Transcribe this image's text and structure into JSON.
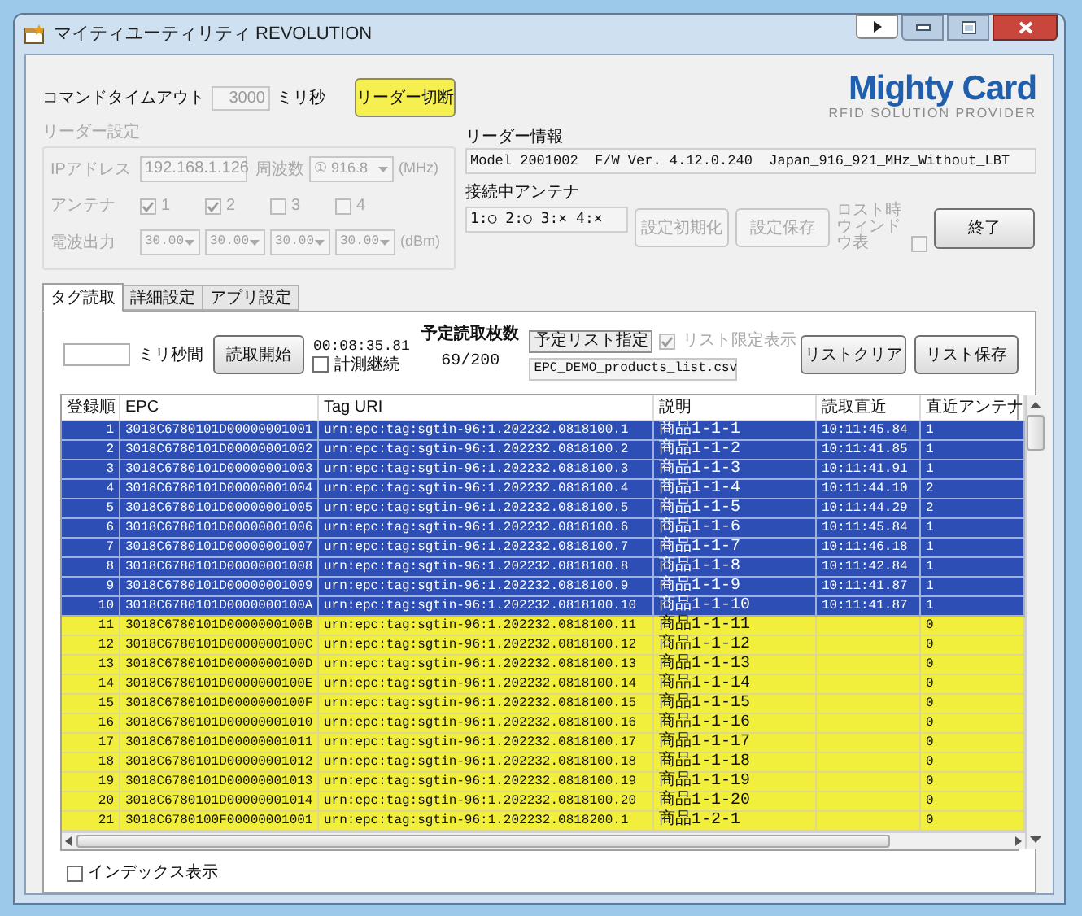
{
  "window": {
    "title": "マイティユーティリティ REVOLUTION"
  },
  "command_timeout": {
    "label": "コマンドタイムアウト",
    "value": "3000",
    "unit": "ミリ秒"
  },
  "disconnect_button": "リーダー切断",
  "reader_settings": {
    "title": "リーダー設定",
    "disabled": true,
    "ip_label": "IPアドレス",
    "ip_value": "192.168.1.126",
    "frequency_label": "周波数",
    "frequency_value": "① 916.8",
    "frequency_unit": "(MHz)",
    "antenna_label": "アンテナ",
    "antennas": [
      {
        "label": "1",
        "checked": true
      },
      {
        "label": "2",
        "checked": true
      },
      {
        "label": "3",
        "checked": false
      },
      {
        "label": "4",
        "checked": false
      }
    ],
    "power_label": "電波出力",
    "powers": [
      "30.00",
      "30.00",
      "30.00",
      "30.00"
    ],
    "power_unit": "(dBm)"
  },
  "logo": {
    "name": "Mighty Card",
    "tagline": "RFID SOLUTION PROVIDER"
  },
  "reader_info": {
    "label": "リーダー情報",
    "value": "Model 2001002  F/W Ver. 4.12.0.240  Japan_916_921_MHz_Without_LBT"
  },
  "connected_antennas": {
    "label": "接続中アンテナ",
    "value": "1:○ 2:○ 3:× 4:×"
  },
  "setting_buttons": [
    {
      "label": "設定初期化",
      "disabled": true
    },
    {
      "label": "設定保存",
      "disabled": true
    }
  ],
  "lost_window_option": {
    "label": "ロスト時ウィンドウ表",
    "checked": false,
    "disabled": true
  },
  "exit_button": "終了",
  "tabs": [
    {
      "label": "タグ読取",
      "selected": true
    },
    {
      "label": "詳細設定",
      "selected": false
    },
    {
      "label": "アプリ設定",
      "selected": false
    }
  ],
  "read_panel": {
    "interval_unit": "ミリ秒間",
    "start_button": "読取開始",
    "elapsed": "00:08:35.81",
    "continue_option": {
      "label": "計測継続",
      "checked": false
    },
    "planned_label": "予定読取枚数",
    "planned_count": "69/200",
    "list_button": "予定リスト指定",
    "list_only_option": {
      "label": "リスト限定表示",
      "checked": true,
      "disabled": true
    },
    "list_file": "EPC_DEMO_products_list.csv",
    "clear_button": "リストクリア",
    "save_button": "リスト保存"
  },
  "table": {
    "columns": [
      "登録順",
      "EPC",
      "Tag URI",
      "説明",
      "読取直近",
      "直近アンテナ"
    ],
    "rows": [
      {
        "no": "1",
        "epc": "3018C6780101D00000001001",
        "tag_uri": "urn:epc:tag:sgtin-96:1.202232.0818100.1",
        "description": "商品1-1-1",
        "last_read": "10:11:45.84",
        "antenna": "1",
        "read": true
      },
      {
        "no": "2",
        "epc": "3018C6780101D00000001002",
        "tag_uri": "urn:epc:tag:sgtin-96:1.202232.0818100.2",
        "description": "商品1-1-2",
        "last_read": "10:11:41.85",
        "antenna": "1",
        "read": true
      },
      {
        "no": "3",
        "epc": "3018C6780101D00000001003",
        "tag_uri": "urn:epc:tag:sgtin-96:1.202232.0818100.3",
        "description": "商品1-1-3",
        "last_read": "10:11:41.91",
        "antenna": "1",
        "read": true
      },
      {
        "no": "4",
        "epc": "3018C6780101D00000001004",
        "tag_uri": "urn:epc:tag:sgtin-96:1.202232.0818100.4",
        "description": "商品1-1-4",
        "last_read": "10:11:44.10",
        "antenna": "2",
        "read": true
      },
      {
        "no": "5",
        "epc": "3018C6780101D00000001005",
        "tag_uri": "urn:epc:tag:sgtin-96:1.202232.0818100.5",
        "description": "商品1-1-5",
        "last_read": "10:11:44.29",
        "antenna": "2",
        "read": true
      },
      {
        "no": "6",
        "epc": "3018C6780101D00000001006",
        "tag_uri": "urn:epc:tag:sgtin-96:1.202232.0818100.6",
        "description": "商品1-1-6",
        "last_read": "10:11:45.84",
        "antenna": "1",
        "read": true
      },
      {
        "no": "7",
        "epc": "3018C6780101D00000001007",
        "tag_uri": "urn:epc:tag:sgtin-96:1.202232.0818100.7",
        "description": "商品1-1-7",
        "last_read": "10:11:46.18",
        "antenna": "1",
        "read": true
      },
      {
        "no": "8",
        "epc": "3018C6780101D00000001008",
        "tag_uri": "urn:epc:tag:sgtin-96:1.202232.0818100.8",
        "description": "商品1-1-8",
        "last_read": "10:11:42.84",
        "antenna": "1",
        "read": true
      },
      {
        "no": "9",
        "epc": "3018C6780101D00000001009",
        "tag_uri": "urn:epc:tag:sgtin-96:1.202232.0818100.9",
        "description": "商品1-1-9",
        "last_read": "10:11:41.87",
        "antenna": "1",
        "read": true
      },
      {
        "no": "10",
        "epc": "3018C6780101D0000000100A",
        "tag_uri": "urn:epc:tag:sgtin-96:1.202232.0818100.10",
        "description": "商品1-1-10",
        "last_read": "10:11:41.87",
        "antenna": "1",
        "read": true
      },
      {
        "no": "11",
        "epc": "3018C6780101D0000000100B",
        "tag_uri": "urn:epc:tag:sgtin-96:1.202232.0818100.11",
        "description": "商品1-1-11",
        "antenna": "0",
        "read": false
      },
      {
        "no": "12",
        "epc": "3018C6780101D0000000100C",
        "tag_uri": "urn:epc:tag:sgtin-96:1.202232.0818100.12",
        "description": "商品1-1-12",
        "antenna": "0",
        "read": false
      },
      {
        "no": "13",
        "epc": "3018C6780101D0000000100D",
        "tag_uri": "urn:epc:tag:sgtin-96:1.202232.0818100.13",
        "description": "商品1-1-13",
        "antenna": "0",
        "read": false
      },
      {
        "no": "14",
        "epc": "3018C6780101D0000000100E",
        "tag_uri": "urn:epc:tag:sgtin-96:1.202232.0818100.14",
        "description": "商品1-1-14",
        "antenna": "0",
        "read": false
      },
      {
        "no": "15",
        "epc": "3018C6780101D0000000100F",
        "tag_uri": "urn:epc:tag:sgtin-96:1.202232.0818100.15",
        "description": "商品1-1-15",
        "antenna": "0",
        "read": false
      },
      {
        "no": "16",
        "epc": "3018C6780101D00000001010",
        "tag_uri": "urn:epc:tag:sgtin-96:1.202232.0818100.16",
        "description": "商品1-1-16",
        "antenna": "0",
        "read": false
      },
      {
        "no": "17",
        "epc": "3018C6780101D00000001011",
        "tag_uri": "urn:epc:tag:sgtin-96:1.202232.0818100.17",
        "description": "商品1-1-17",
        "antenna": "0",
        "read": false
      },
      {
        "no": "18",
        "epc": "3018C6780101D00000001012",
        "tag_uri": "urn:epc:tag:sgtin-96:1.202232.0818100.18",
        "description": "商品1-1-18",
        "antenna": "0",
        "read": false
      },
      {
        "no": "19",
        "epc": "3018C6780101D00000001013",
        "tag_uri": "urn:epc:tag:sgtin-96:1.202232.0818100.19",
        "description": "商品1-1-19",
        "antenna": "0",
        "read": false
      },
      {
        "no": "20",
        "epc": "3018C6780101D00000001014",
        "tag_uri": "urn:epc:tag:sgtin-96:1.202232.0818100.20",
        "description": "商品1-1-20",
        "antenna": "0",
        "read": false
      },
      {
        "no": "21",
        "epc": "3018C6780100F00000001001",
        "tag_uri": "urn:epc:tag:sgtin-96:1.202232.0818200.1",
        "description": "商品1-2-1",
        "antenna": "0",
        "read": false
      }
    ]
  },
  "index_display_option": {
    "label": "インデックス表示",
    "checked": false
  }
}
